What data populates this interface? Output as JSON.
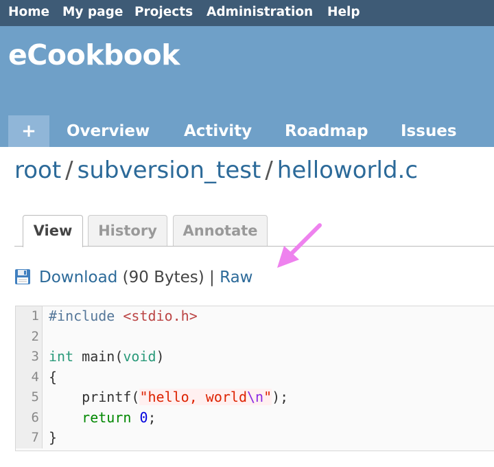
{
  "top_menu": {
    "items": [
      "Home",
      "My page",
      "Projects",
      "Administration",
      "Help"
    ]
  },
  "header": {
    "title": "eCookbook"
  },
  "main_menu": {
    "new_label": "+",
    "items": [
      "Overview",
      "Activity",
      "Roadmap",
      "Issues"
    ]
  },
  "breadcrumb": {
    "parts": [
      "root",
      "subversion_test",
      "helloworld.c"
    ],
    "separator": "/"
  },
  "tabs": {
    "items": [
      "View",
      "History",
      "Annotate"
    ],
    "selected": "View"
  },
  "download": {
    "icon": "floppy-disk-icon",
    "link": "Download",
    "size": "(90 Bytes)",
    "separator": "|",
    "raw": "Raw"
  },
  "code": {
    "line_numbers": [
      "1",
      "2",
      "3",
      "4",
      "5",
      "6",
      "7"
    ],
    "lines": [
      "#include <stdio.h>",
      "",
      "int main(void)",
      "{",
      "    printf(\"hello, world\\n\");",
      "    return 0;",
      "}"
    ]
  },
  "colors": {
    "top_menu_bg": "#3e5b76",
    "header_bg": "#6fa0c8",
    "link": "#2c6a99",
    "annotation_arrow": "#ee82ee"
  }
}
